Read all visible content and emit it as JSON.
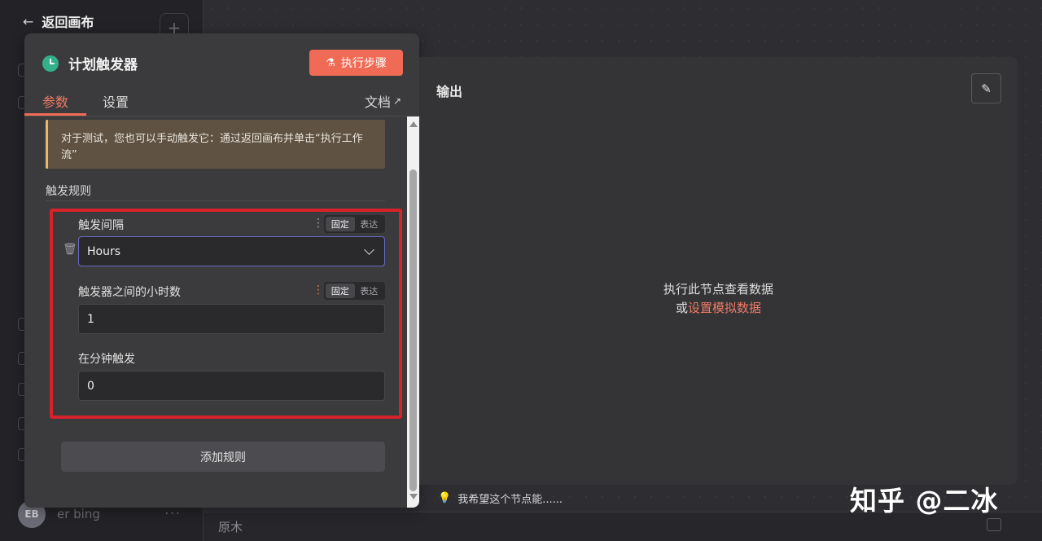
{
  "nav": {
    "back_label": "返回画布"
  },
  "node": {
    "title": "计划触发器",
    "execute_label": "执行步骤"
  },
  "tabs": [
    {
      "label": "参数",
      "active": true
    },
    {
      "label": "设置",
      "active": false
    },
    {
      "label": "文档",
      "active": false
    }
  ],
  "notice": {
    "text": "对于测试，您也可以手动触发它：通过返回画布并单击“执行工作流”"
  },
  "trigger_rules": {
    "section_title": "触发规则",
    "fields": [
      {
        "label": "触发间隔",
        "type": "select",
        "value": "Hours"
      },
      {
        "label": "触发器之间的小时数",
        "type": "text",
        "value": "1"
      },
      {
        "label": "在分钟触发",
        "type": "text",
        "value": "0"
      }
    ],
    "mode_toggle": {
      "fixed": "固定",
      "expression": "表达"
    },
    "add_rule_label": "添加规则"
  },
  "output": {
    "title": "输出",
    "empty_line1": "执行此节点查看数据",
    "empty_line2_prefix": "或",
    "empty_line2_link": "设置模拟数据"
  },
  "feedback": {
    "text": "我希望这个节点能......"
  },
  "background": {
    "user_initials": "EB",
    "user_name": "er bing",
    "bottom_label": "原木"
  },
  "watermark": "知乎 @二冰",
  "colors": {
    "accent": "#ef6b55",
    "trigger_icon": "#34b08a",
    "highlight_border": "#d5222b",
    "notice_border": "#e8b769"
  }
}
